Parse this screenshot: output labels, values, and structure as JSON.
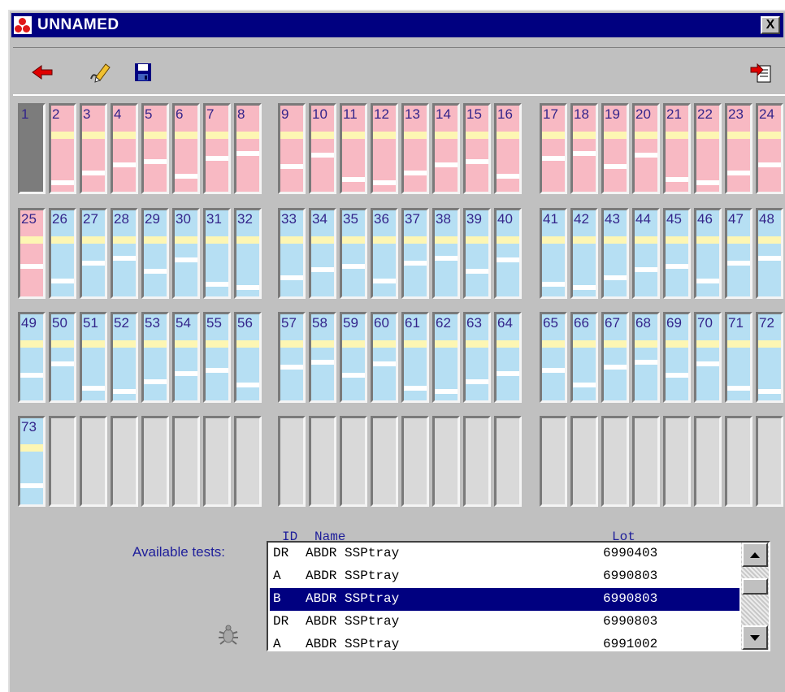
{
  "window": {
    "title": "UNNAMED",
    "close_label": "X"
  },
  "toolbar": {
    "buttons": [
      {
        "name": "back-arrow-icon"
      },
      {
        "name": "edit-pen-icon"
      },
      {
        "name": "save-disk-icon"
      },
      {
        "name": "export-document-icon"
      }
    ]
  },
  "colors": {
    "titlebar": "#000080",
    "pink_slot": "#f8b9c3",
    "blue_slot": "#b6dff3",
    "yellow_band": "#fdf6b3",
    "numbers": "#33248a",
    "selection": "#000080"
  },
  "slots": [
    {
      "n": "1",
      "state": "dark"
    },
    {
      "n": "2",
      "state": "pink"
    },
    {
      "n": "3",
      "state": "pink"
    },
    {
      "n": "4",
      "state": "pink"
    },
    {
      "n": "5",
      "state": "pink"
    },
    {
      "n": "6",
      "state": "pink"
    },
    {
      "n": "7",
      "state": "pink"
    },
    {
      "n": "8",
      "state": "pink"
    },
    {
      "n": "9",
      "state": "pink"
    },
    {
      "n": "10",
      "state": "pink"
    },
    {
      "n": "11",
      "state": "pink"
    },
    {
      "n": "12",
      "state": "pink"
    },
    {
      "n": "13",
      "state": "pink"
    },
    {
      "n": "14",
      "state": "pink"
    },
    {
      "n": "15",
      "state": "pink"
    },
    {
      "n": "16",
      "state": "pink"
    },
    {
      "n": "17",
      "state": "pink"
    },
    {
      "n": "18",
      "state": "pink"
    },
    {
      "n": "19",
      "state": "pink"
    },
    {
      "n": "20",
      "state": "pink"
    },
    {
      "n": "21",
      "state": "pink"
    },
    {
      "n": "22",
      "state": "pink"
    },
    {
      "n": "23",
      "state": "pink"
    },
    {
      "n": "24",
      "state": "pink"
    },
    {
      "n": "25",
      "state": "pink"
    },
    {
      "n": "26",
      "state": "blue"
    },
    {
      "n": "27",
      "state": "blue"
    },
    {
      "n": "28",
      "state": "blue"
    },
    {
      "n": "29",
      "state": "blue"
    },
    {
      "n": "30",
      "state": "blue"
    },
    {
      "n": "31",
      "state": "blue"
    },
    {
      "n": "32",
      "state": "blue"
    },
    {
      "n": "33",
      "state": "blue"
    },
    {
      "n": "34",
      "state": "blue"
    },
    {
      "n": "35",
      "state": "blue"
    },
    {
      "n": "36",
      "state": "blue"
    },
    {
      "n": "37",
      "state": "blue"
    },
    {
      "n": "38",
      "state": "blue"
    },
    {
      "n": "39",
      "state": "blue"
    },
    {
      "n": "40",
      "state": "blue"
    },
    {
      "n": "41",
      "state": "blue"
    },
    {
      "n": "42",
      "state": "blue"
    },
    {
      "n": "43",
      "state": "blue"
    },
    {
      "n": "44",
      "state": "blue"
    },
    {
      "n": "45",
      "state": "blue"
    },
    {
      "n": "46",
      "state": "blue"
    },
    {
      "n": "47",
      "state": "blue"
    },
    {
      "n": "48",
      "state": "blue"
    },
    {
      "n": "49",
      "state": "blue"
    },
    {
      "n": "50",
      "state": "blue"
    },
    {
      "n": "51",
      "state": "blue"
    },
    {
      "n": "52",
      "state": "blue"
    },
    {
      "n": "53",
      "state": "blue"
    },
    {
      "n": "54",
      "state": "blue"
    },
    {
      "n": "55",
      "state": "blue"
    },
    {
      "n": "56",
      "state": "blue"
    },
    {
      "n": "57",
      "state": "blue"
    },
    {
      "n": "58",
      "state": "blue"
    },
    {
      "n": "59",
      "state": "blue"
    },
    {
      "n": "60",
      "state": "blue"
    },
    {
      "n": "61",
      "state": "blue"
    },
    {
      "n": "62",
      "state": "blue"
    },
    {
      "n": "63",
      "state": "blue"
    },
    {
      "n": "64",
      "state": "blue"
    },
    {
      "n": "65",
      "state": "blue"
    },
    {
      "n": "66",
      "state": "blue"
    },
    {
      "n": "67",
      "state": "blue"
    },
    {
      "n": "68",
      "state": "blue"
    },
    {
      "n": "69",
      "state": "blue"
    },
    {
      "n": "70",
      "state": "blue"
    },
    {
      "n": "71",
      "state": "blue"
    },
    {
      "n": "72",
      "state": "blue"
    },
    {
      "n": "73",
      "state": "blue"
    },
    {
      "n": "",
      "state": "empty"
    },
    {
      "n": "",
      "state": "empty"
    },
    {
      "n": "",
      "state": "empty"
    },
    {
      "n": "",
      "state": "empty"
    },
    {
      "n": "",
      "state": "empty"
    },
    {
      "n": "",
      "state": "empty"
    },
    {
      "n": "",
      "state": "empty"
    },
    {
      "n": "",
      "state": "empty"
    },
    {
      "n": "",
      "state": "empty"
    },
    {
      "n": "",
      "state": "empty"
    },
    {
      "n": "",
      "state": "empty"
    },
    {
      "n": "",
      "state": "empty"
    },
    {
      "n": "",
      "state": "empty"
    },
    {
      "n": "",
      "state": "empty"
    },
    {
      "n": "",
      "state": "empty"
    },
    {
      "n": "",
      "state": "empty"
    },
    {
      "n": "",
      "state": "empty"
    },
    {
      "n": "",
      "state": "empty"
    },
    {
      "n": "",
      "state": "empty"
    },
    {
      "n": "",
      "state": "empty"
    },
    {
      "n": "",
      "state": "empty"
    },
    {
      "n": "",
      "state": "empty"
    },
    {
      "n": "",
      "state": "empty"
    }
  ],
  "tests": {
    "label": "Available tests:",
    "columns": {
      "id": "ID",
      "name": "Name",
      "lot": "Lot"
    },
    "rows": [
      {
        "id": "DR",
        "name": "ABDR SSPtray",
        "lot": "6990403",
        "selected": false
      },
      {
        "id": "A",
        "name": "ABDR SSPtray",
        "lot": "6990803",
        "selected": false
      },
      {
        "id": "B",
        "name": "ABDR SSPtray",
        "lot": "6990803",
        "selected": true
      },
      {
        "id": "DR",
        "name": "ABDR SSPtray",
        "lot": "6990803",
        "selected": false
      },
      {
        "id": "A",
        "name": "ABDR SSPtray",
        "lot": "6991002",
        "selected": false
      }
    ]
  }
}
